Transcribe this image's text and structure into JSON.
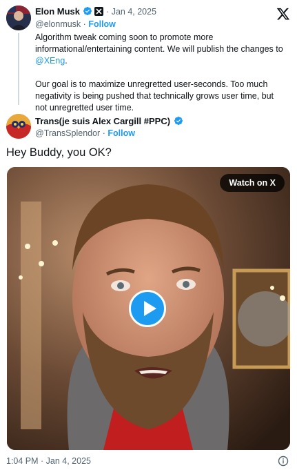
{
  "quoted": {
    "name": "Elon Musk",
    "handle": "@elonmusk",
    "date": "Jan 4, 2025",
    "separator": "·",
    "follow": "Follow",
    "body_line1": "Algorithm tweak coming soon to promote more informational/entertaining content. We will publish the changes to",
    "body_link": "@XEng",
    "body_end": ".",
    "body_para2": "Our goal is to maximize unregretted user-seconds. Too much negativity is being pushed that technically grows user time, but not unregretted user time."
  },
  "author": {
    "name": "Trans(je suis Alex Cargill #PPC)",
    "handle": "@TransSplendor",
    "separator": "·",
    "follow": "Follow"
  },
  "tweet": {
    "text": "Hey Buddy, you OK?",
    "video_button": "Watch on X"
  },
  "footer": {
    "timestamp": "1:04 PM · Jan 4, 2025"
  },
  "icons": {
    "x_logo": "x-logo-icon",
    "verified": "verified-badge-icon",
    "affiliate": "x-affiliate-badge-icon",
    "play": "play-icon",
    "info": "info-icon"
  },
  "colors": {
    "accent": "#1d9bf0",
    "muted": "#536471",
    "text": "#0f1419"
  }
}
